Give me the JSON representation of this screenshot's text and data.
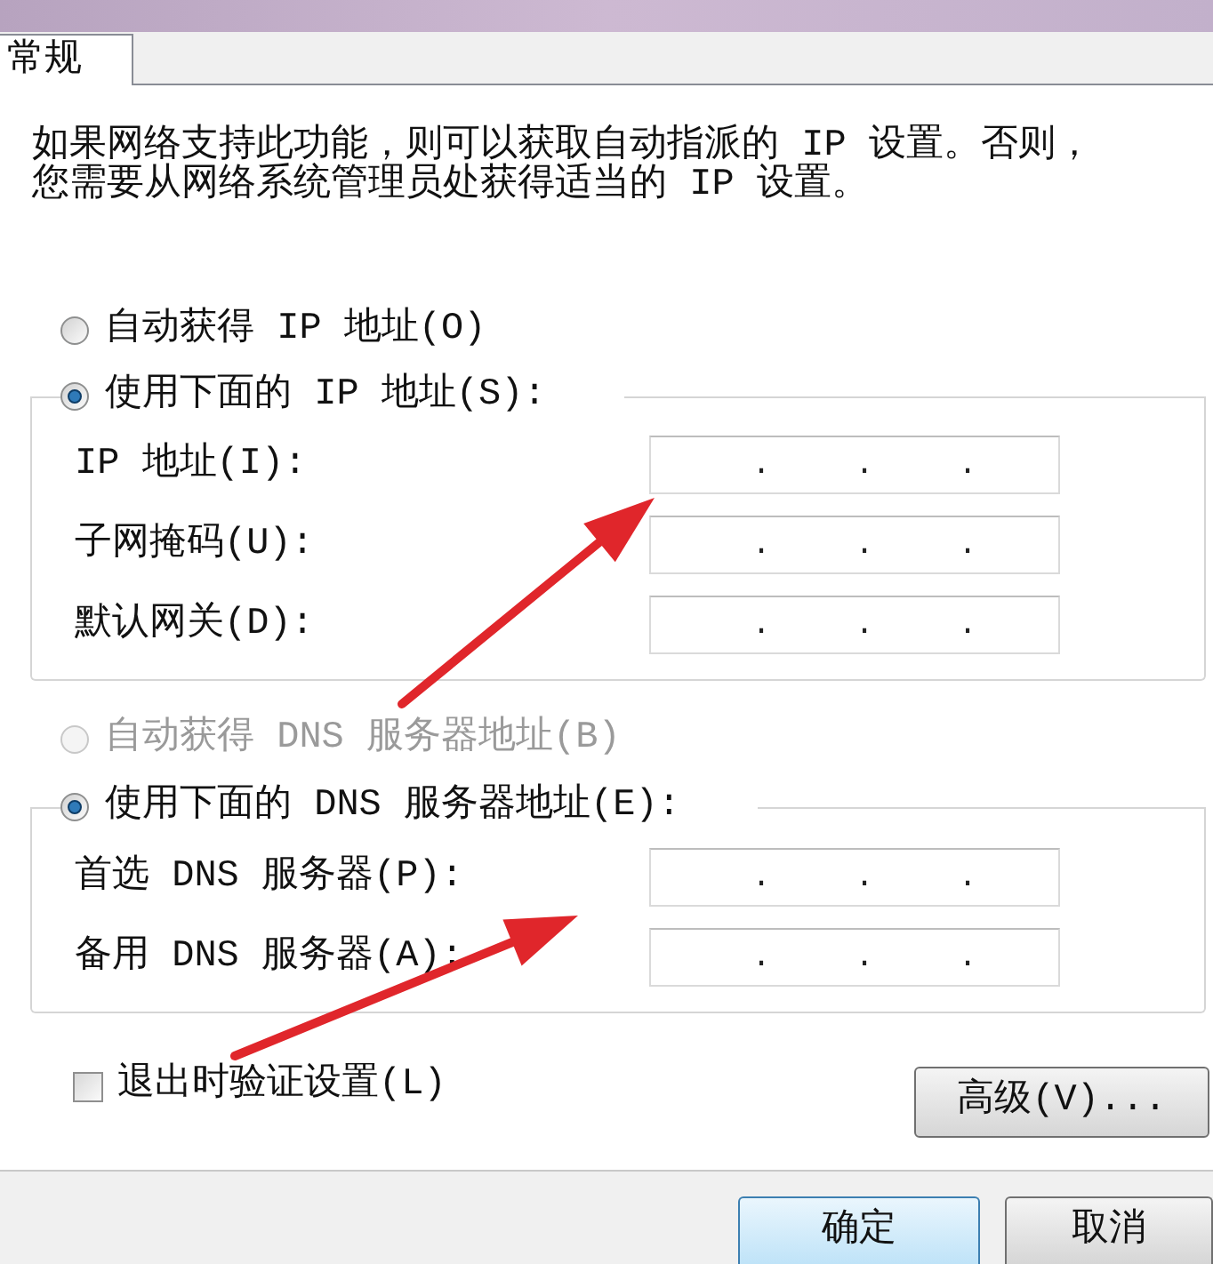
{
  "tabs": [
    {
      "label": "常规",
      "selected": true
    }
  ],
  "description": "如果网络支持此功能，则可以获取自动指派的 IP 设置。否则，您需要从网络系统管理员处获得适当的 IP 设置。",
  "ip_settings": {
    "options": [
      {
        "label": "自动获得 IP 地址(O)",
        "selected": false,
        "disabled": false
      },
      {
        "label": "使用下面的 IP 地址(S):",
        "selected": true,
        "disabled": false
      }
    ],
    "fields": [
      {
        "label": "IP 地址(I):",
        "separators": [
          ".",
          ".",
          "."
        ]
      },
      {
        "label": "子网掩码(U):",
        "separators": [
          ".",
          ".",
          "."
        ]
      },
      {
        "label": "默认网关(D):",
        "separators": [
          ".",
          ".",
          "."
        ]
      }
    ]
  },
  "dns_settings": {
    "options": [
      {
        "label": "自动获得 DNS 服务器地址(B)",
        "selected": false,
        "disabled": true
      },
      {
        "label": "使用下面的 DNS 服务器地址(E):",
        "selected": true,
        "disabled": false
      }
    ],
    "fields": [
      {
        "label": "首选 DNS 服务器(P):",
        "separators": [
          ".",
          ".",
          "."
        ]
      },
      {
        "label": "备用 DNS 服务器(A):",
        "separators": [
          ".",
          ".",
          "."
        ]
      }
    ]
  },
  "validate_checkbox": {
    "label": "退出时验证设置(L)",
    "checked": false
  },
  "advanced_button": {
    "label": "高级(V)..."
  },
  "buttons": [
    {
      "label": "确定",
      "default": true
    },
    {
      "label": "取消",
      "default": false
    }
  ]
}
